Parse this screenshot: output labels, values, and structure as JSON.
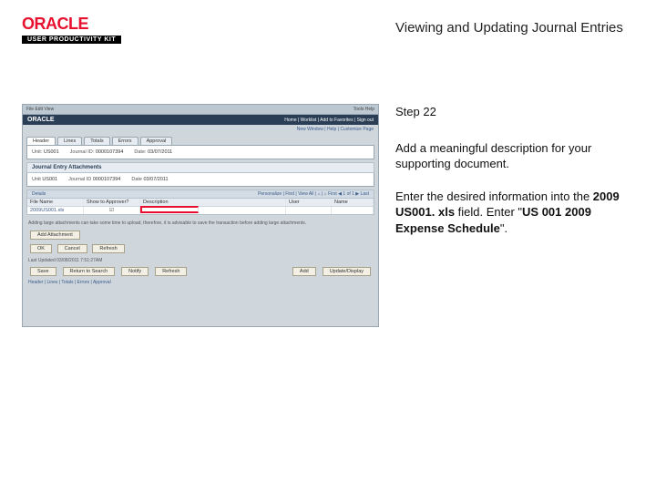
{
  "header": {
    "logo_text": "ORACLE",
    "upk_text": "USER PRODUCTIVITY KIT",
    "page_title": "Viewing and Updating Journal Entries"
  },
  "instructions": {
    "step_label": "Step 22",
    "line1": "Add a meaningful description for your supporting document.",
    "line2_pre": "Enter the desired information into the ",
    "line2_field": "2009 US001. xls",
    "line2_mid": " field. Enter \"",
    "line2_value": "US 001 2009 Expense Schedule",
    "line2_post": "\"."
  },
  "shot": {
    "browser_bar_left": "File  Edit  View",
    "browser_bar_right": "Tools  Help",
    "oracle_brand": "ORACLE",
    "oracle_right": "Home | Worklist | Add to Favorites | Sign out",
    "nav_right": "New Window | Help | Customize Page",
    "tabs": [
      "Header",
      "Lines",
      "Totals",
      "Errors",
      "Approval"
    ],
    "panel_fields": {
      "unit_lbl": "Unit:",
      "unit_val": "US001",
      "jid_lbl": "Journal ID:",
      "jid_val": "0000107394",
      "date_lbl": "Date:",
      "date_val": "03/07/2011"
    },
    "attach_header": "Journal Entry Attachments",
    "attach_fields": {
      "unit_lbl": "Unit",
      "unit_val": "US001",
      "jid_lbl": "Journal ID",
      "jid_val": "0000107394",
      "date_lbl": "Date",
      "date_val": "03/07/2011"
    },
    "details_left": "Details",
    "details_right": "Personalize | Find | View All | ⌂ | ⌂    First ◀ 1 of 1 ▶ Last",
    "grid_headers": [
      "File Name",
      "Show to Approver?",
      "Description",
      "User",
      "Name"
    ],
    "grid_row": [
      "2009US001.xls",
      "☑",
      "",
      "",
      ""
    ],
    "note": "Adding large attachments can take some time to upload, therefore, it is advisable to save the transaction before adding large attachments.",
    "btn_add": "Add Attachment",
    "btn_ok": "OK",
    "btn_cancel": "Cancel",
    "btn_refresh": "Refresh",
    "last_updated": "Last Updated 03/08/2011  7:51:27AM",
    "bottom_save": "Save",
    "bottom_return": "Return to Search",
    "bottom_notify": "Notify",
    "bottom_refresh": "Refresh",
    "bottom_add": "Add",
    "bottom_update": "Update/Display",
    "tab_links": "Header | Lines | Totals | Errors | Approval"
  }
}
